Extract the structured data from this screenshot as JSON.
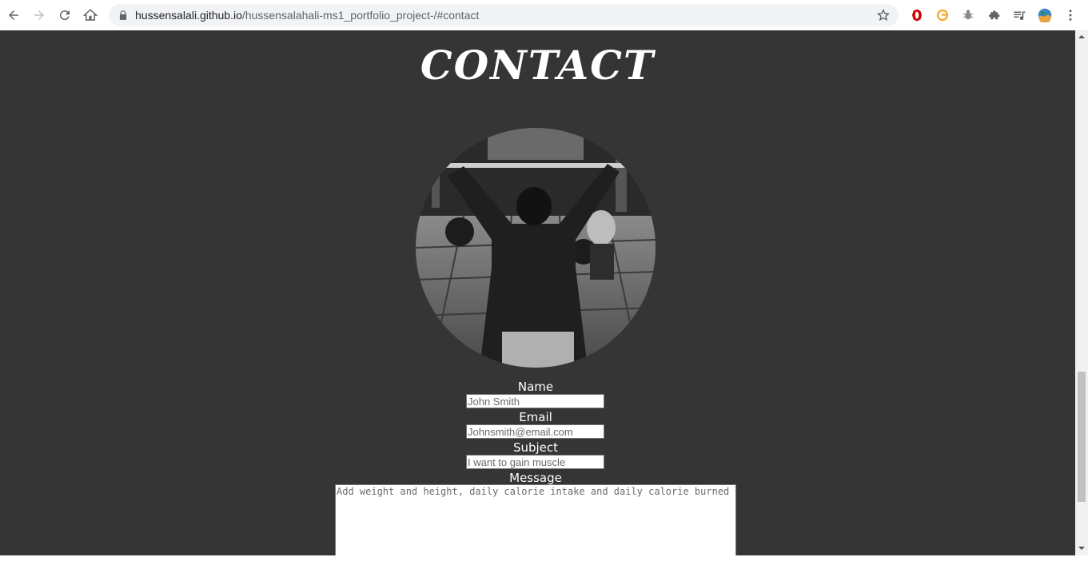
{
  "browser": {
    "url_domain": "hussensalali.github.io",
    "url_path": "/hussensalahali-ms1_portfolio_project-/#contact"
  },
  "page": {
    "heading": "CONTACT",
    "photo_alt": "Weightlifting gym photo",
    "form": {
      "name_label": "Name",
      "name_placeholder": "John Smith",
      "email_label": "Email",
      "email_placeholder": "Johnsmith@email.com",
      "subject_label": "Subject",
      "subject_placeholder": "I want to gain muscle",
      "message_label": "Message",
      "message_placeholder": "Add weight and height, daily calorie intake and daily calorie burned"
    }
  },
  "colors": {
    "page_background": "#353535",
    "text": "#ffffff",
    "browser_toolbar": "#ffffff",
    "omnibox": "#f1f3f4"
  }
}
